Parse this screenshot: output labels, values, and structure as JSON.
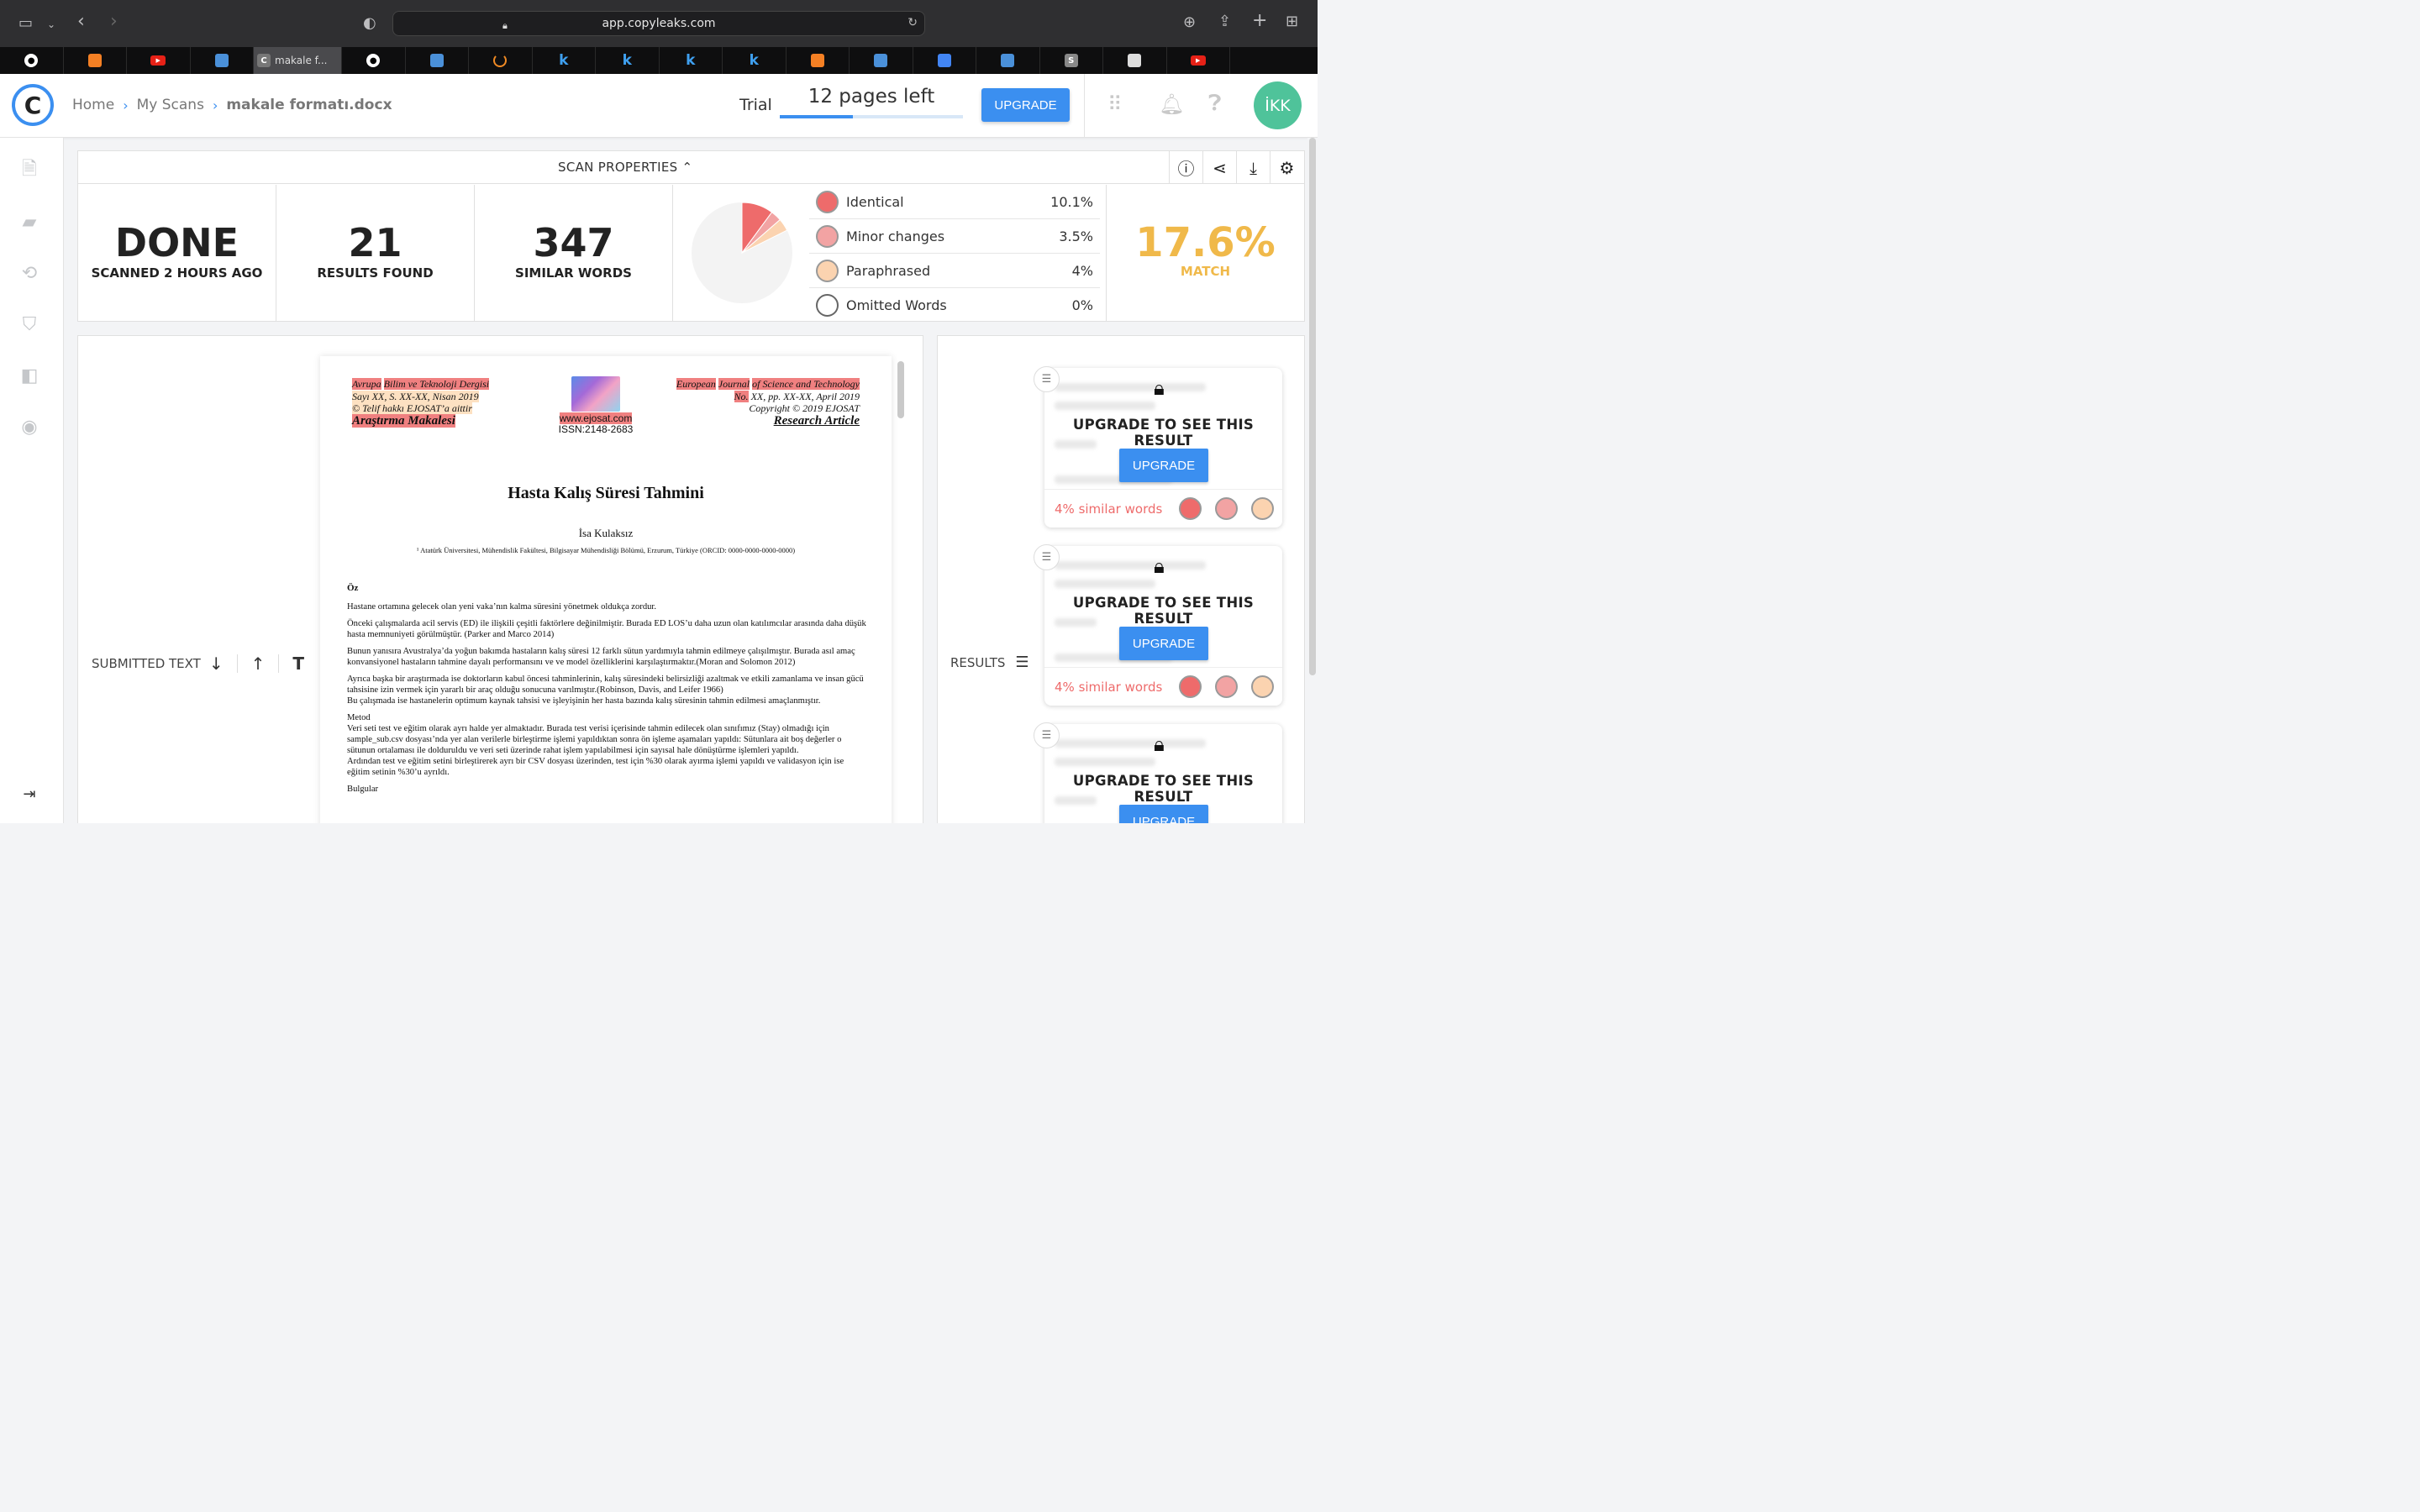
{
  "browser": {
    "url": "app.copyleaks.com",
    "active_tab_label": "makale f...",
    "tabs": [
      {
        "icon": "github-icon",
        "label": ""
      },
      {
        "icon": "stackoverflow-icon",
        "label": ""
      },
      {
        "icon": "youtube-icon",
        "label": ""
      },
      {
        "icon": "app-icon",
        "label": ""
      },
      {
        "icon": "copyleaks-icon",
        "label": "makale f..."
      },
      {
        "icon": "github-icon",
        "label": ""
      },
      {
        "icon": "app-icon",
        "label": ""
      },
      {
        "icon": "loader-icon",
        "label": ""
      },
      {
        "icon": "k-icon",
        "label": "k"
      },
      {
        "icon": "k-icon",
        "label": "k"
      },
      {
        "icon": "k-icon",
        "label": "k"
      },
      {
        "icon": "k-icon",
        "label": "k"
      },
      {
        "icon": "stackoverflow-icon",
        "label": ""
      },
      {
        "icon": "app-icon",
        "label": ""
      },
      {
        "icon": "translate-icon",
        "label": ""
      },
      {
        "icon": "app-icon",
        "label": ""
      },
      {
        "icon": "s-icon",
        "label": "S"
      },
      {
        "icon": "chart-icon",
        "label": ""
      },
      {
        "icon": "youtube-icon",
        "label": ""
      }
    ]
  },
  "header": {
    "logo": "C",
    "breadcrumb": [
      "Home",
      "My Scans",
      "makale formatı.docx"
    ],
    "trial_label": "Trial",
    "pages_left": "12 pages left",
    "pages_progress": 0.4,
    "upgrade_label": "UPGRADE",
    "avatar_initials": "İKK"
  },
  "scan_properties": {
    "title": "SCAN PROPERTIES",
    "status": {
      "value": "DONE",
      "label": "SCANNED 2 HOURS AGO"
    },
    "results": {
      "value": "21",
      "label": "RESULTS FOUND"
    },
    "similar": {
      "value": "347",
      "label": "SIMILAR WORDS"
    },
    "legend": [
      {
        "name": "Identical",
        "pct": "10.1%",
        "color": "#ee6b6b"
      },
      {
        "name": "Minor changes",
        "pct": "3.5%",
        "color": "#f2a3a3"
      },
      {
        "name": "Paraphrased",
        "pct": "4%",
        "color": "#fbd3b0"
      },
      {
        "name": "Omitted Words",
        "pct": "0%",
        "color": "#ffffff"
      }
    ],
    "match": {
      "value": "17.6%",
      "label": "MATCH"
    }
  },
  "document": {
    "controls_label": "SUBMITTED TEXT",
    "journal_left": [
      "Avrupa",
      "Bilim ve Teknoloji Dergisi",
      "Sayı XX, S. XX-XX, Nisan 2019",
      "© Telif hakkı EJOSAT’a aittir",
      "Araştırma Makalesi"
    ],
    "journal_center": [
      "www.ejosat.com",
      "ISSN:2148-2683"
    ],
    "journal_right": [
      "European",
      "Journal",
      "of Science and Technology",
      "No.",
      "XX, pp. XX-XX, April 2019",
      "Copyright © 2019 EJOSAT",
      "Research Article"
    ],
    "title": "Hasta Kalış Süresi Tahmini",
    "author": "İsa Kulaksız",
    "affiliation": "¹ Atatürk Üniversitesi, Mühendislik Fakültesi, Bilgisayar Mühendisliği Bölümü, Erzurum, Türkiye (ORCID: 0000-0000-0000-0000)",
    "oz_heading": "Öz",
    "paragraphs": [
      "Hastane ortamına gelecek olan yeni vaka’nın kalma süresini yönetmek oldukça zordur.",
      "Önceki çalışmalarda acil servis (ED) ile ilişkili çeşitli faktörlere değinilmiştir. Burada ED LOS’u daha uzun olan katılımcılar arasında daha düşük hasta memnuniyeti görülmüştür. (Parker and Marco 2014)",
      "Bunun yanısıra Avustralya’da yoğun bakımda hastaların kalış süresi 12 farklı sütun yardımıyla tahmin edilmeye çalışılmıştır. Burada asıl amaç konvansiyonel hastaların tahmine dayalı performansını ve  ve model özelliklerini karşılaştırmaktır.(Moran and Solomon 2012)",
      "Ayrıca başka bir araştırmada ise doktorların kabul öncesi tahminlerinin, kalış süresindeki belirsizliği azaltmak ve etkili zamanlama ve insan gücü tahsisine izin vermek için yararlı bir araç olduğu sonucuna varılmıştır.(Robinson, Davis, and Leifer 1966)\nBu çalışmada ise hastanelerin optimum kaynak tahsisi ve işleyişinin her hasta bazında kalış süresinin tahmin edilmesi amaçlanmıştır.",
      "Metod\nVeri seti test ve eğitim olarak ayrı halde yer almaktadır. Burada test verisi içerisinde tahmin edilecek olan sınıfımız (Stay) olmadığı için sample_sub.csv dosyası’nda yer alan verilerle birleştirme işlemi yapıldıktan sonra ön işleme aşamaları yapıldı: Sütunlara ait boş değerler o sütunun ortalaması ile dolduruldu ve veri seti üzerinde rahat işlem yapılabilmesi için sayısal hale dönüştürme işlemleri yapıldı.\nArdından test ve eğitim setini birleştirerek ayrı bir CSV dosyası üzerinden, test için %30 olarak ayırma işlemi yapıldı ve validasyon için ise eğitim setinin %30’u ayrıldı.",
      "Bulgular"
    ]
  },
  "results": {
    "controls_label": "RESULTS",
    "cards": [
      {
        "title": "UPGRADE TO SEE THIS RESULT",
        "button": "UPGRADE",
        "similar": "4% similar words"
      },
      {
        "title": "UPGRADE TO SEE THIS RESULT",
        "button": "UPGRADE",
        "similar": "4% similar words"
      },
      {
        "title": "UPGRADE TO SEE THIS RESULT",
        "button": "UPGRADE",
        "similar": ""
      }
    ]
  },
  "pie": {
    "slices": [
      {
        "name": "Identical",
        "value": 10.1,
        "color": "#ee6b6b"
      },
      {
        "name": "Minor changes",
        "value": 3.5,
        "color": "#f2a3a3"
      },
      {
        "name": "Paraphrased",
        "value": 4,
        "color": "#fbd3b0"
      },
      {
        "name": "Rest",
        "value": 82.4,
        "color": "#f3f3f3"
      }
    ]
  }
}
